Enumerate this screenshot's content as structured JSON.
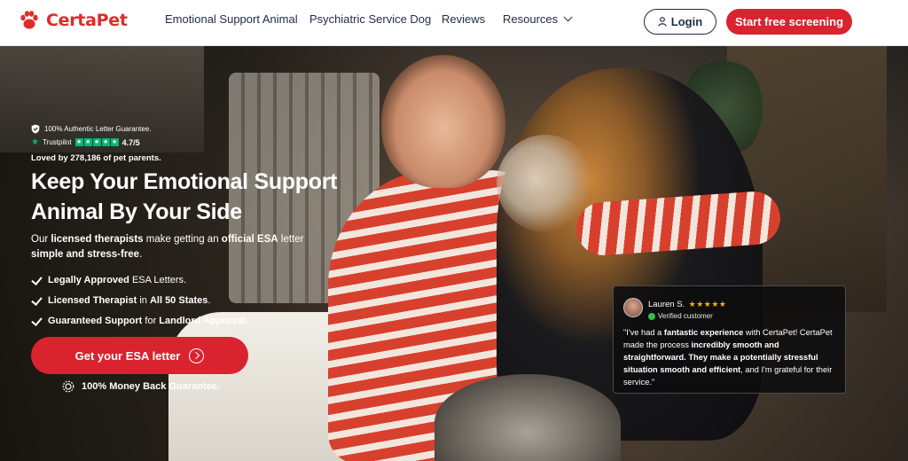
{
  "header": {
    "logo_text": "CertaPet",
    "nav": [
      {
        "label": "Emotional Support Animal"
      },
      {
        "label": "Psychiatric Service Dog"
      },
      {
        "label": "Reviews"
      },
      {
        "label": "Resources"
      }
    ],
    "login_label": "Login",
    "screening_label": "Start free screening"
  },
  "hero": {
    "guarantee_text": "100% Authentic Letter Guarantee.",
    "trustpilot_label": "Trustpilot",
    "rating": "4.7/5",
    "loved_text": "Loved by 278,186 of pet parents.",
    "headline_line1": "Keep Your Emotional Support",
    "headline_line2": "Animal By Your Side",
    "sub": {
      "p1": "Our ",
      "b1": "licensed therapists",
      "p2": " make getting an ",
      "b2": "official ESA",
      "p3": " letter",
      "b3": "simple and stress-free",
      "p4": "."
    },
    "checks": [
      {
        "bold": "Legally Approved",
        "rest": " ESA Letters."
      },
      {
        "bold": "Licensed Therapist",
        "mid": " in ",
        "bold2": "All 50 States",
        "rest": "."
      },
      {
        "bold": "Guaranteed Support",
        "mid": " for ",
        "bold2": "Landlord Approval",
        "rest": "."
      }
    ],
    "cta_label": "Get your ESA letter",
    "money_back": "100% Money Back Guarantee."
  },
  "review": {
    "name": "Lauren S.",
    "stars": "★★★★★",
    "verified": "Verified customer",
    "t1": "\"I've had a ",
    "b1": "fantastic experience",
    "t2": " with CertaPet! CertaPet made the process ",
    "b2": "incredibly smooth and straightforward. They make a potentially stressful situation smooth and efficient",
    "t3": ", and I'm grateful for their service.\""
  },
  "colors": {
    "brand_red": "#d9232f",
    "trustpilot_green": "#00b67a",
    "star_gold": "#f5b400"
  }
}
